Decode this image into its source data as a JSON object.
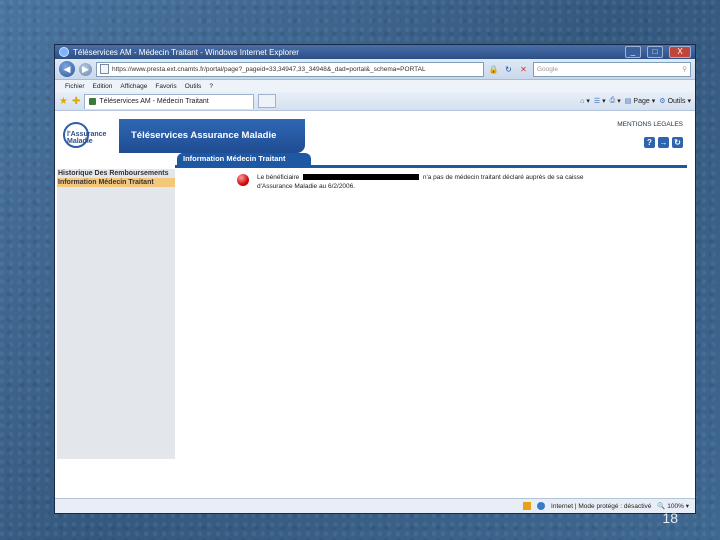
{
  "window": {
    "title": "Téléservices AM - Médecin Traitant - Windows Internet Explorer",
    "min": "_",
    "max": "□",
    "close": "X"
  },
  "addressbar": {
    "url": "https://www.presta.ext.cnamts.fr/portal/page?_pageid=33,34947,33_34948&_dad=portal&_schema=PORTAL",
    "search_placeholder": "Google",
    "search_icon": "⚲"
  },
  "menubar": {
    "items": [
      "Fichier",
      "Edition",
      "Affichage",
      "Favoris",
      "Outils",
      "?"
    ]
  },
  "tabbar": {
    "tab_title": "Téléservices AM - Médecin Traitant",
    "page_label": "Page",
    "tools_label": "Outils"
  },
  "header": {
    "logo_text": "l'Assurance Maladie",
    "banner_title": "Téléservices Assurance Maladie",
    "mentions": "MENTIONS LEGALES",
    "icons": [
      "?",
      "→",
      "↻"
    ]
  },
  "sidebar": {
    "items": [
      {
        "label": "Historique Des Remboursements",
        "active": false
      },
      {
        "label": "Information Médecin Traitant",
        "active": true
      }
    ]
  },
  "section": {
    "title": "Information Médecin Traitant"
  },
  "notice": {
    "prefix": "Le bénéficiaire",
    "suffix": "n'a pas de médecin traitant déclaré auprès de sa caisse",
    "line2": "d'Assurance Maladie au 6/2/2006."
  },
  "statusbar": {
    "zone": "Internet | Mode protégé : désactivé",
    "zoom": "100%"
  },
  "slide": {
    "number": "18"
  }
}
